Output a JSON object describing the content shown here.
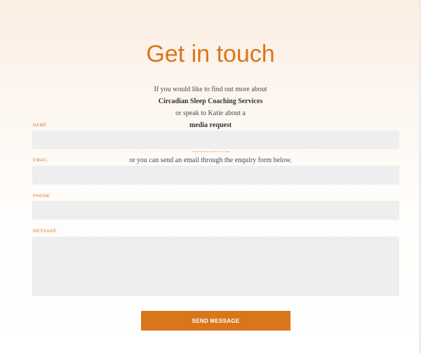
{
  "page": {
    "title": "Get in touch",
    "intro": {
      "line1": "If you would like to find out more about",
      "line2": "Circadian Sleep Coaching Services",
      "line3": "or speak to Katie about a",
      "line4": "media request",
      "line5": "or you can send an email through the enquiry form below."
    }
  },
  "form": {
    "name_label": "NAME",
    "name_value": "",
    "email_label": "EMAIL",
    "email_value": "",
    "phone_label": "PHONE",
    "phone_value": "",
    "message_label": "MESSAGE",
    "message_value": "",
    "submit_label": "SEND MESSAGE"
  },
  "colors": {
    "accent": "#d9761b",
    "field_background": "#eeeeee",
    "body_text": "#4a4a4a"
  }
}
